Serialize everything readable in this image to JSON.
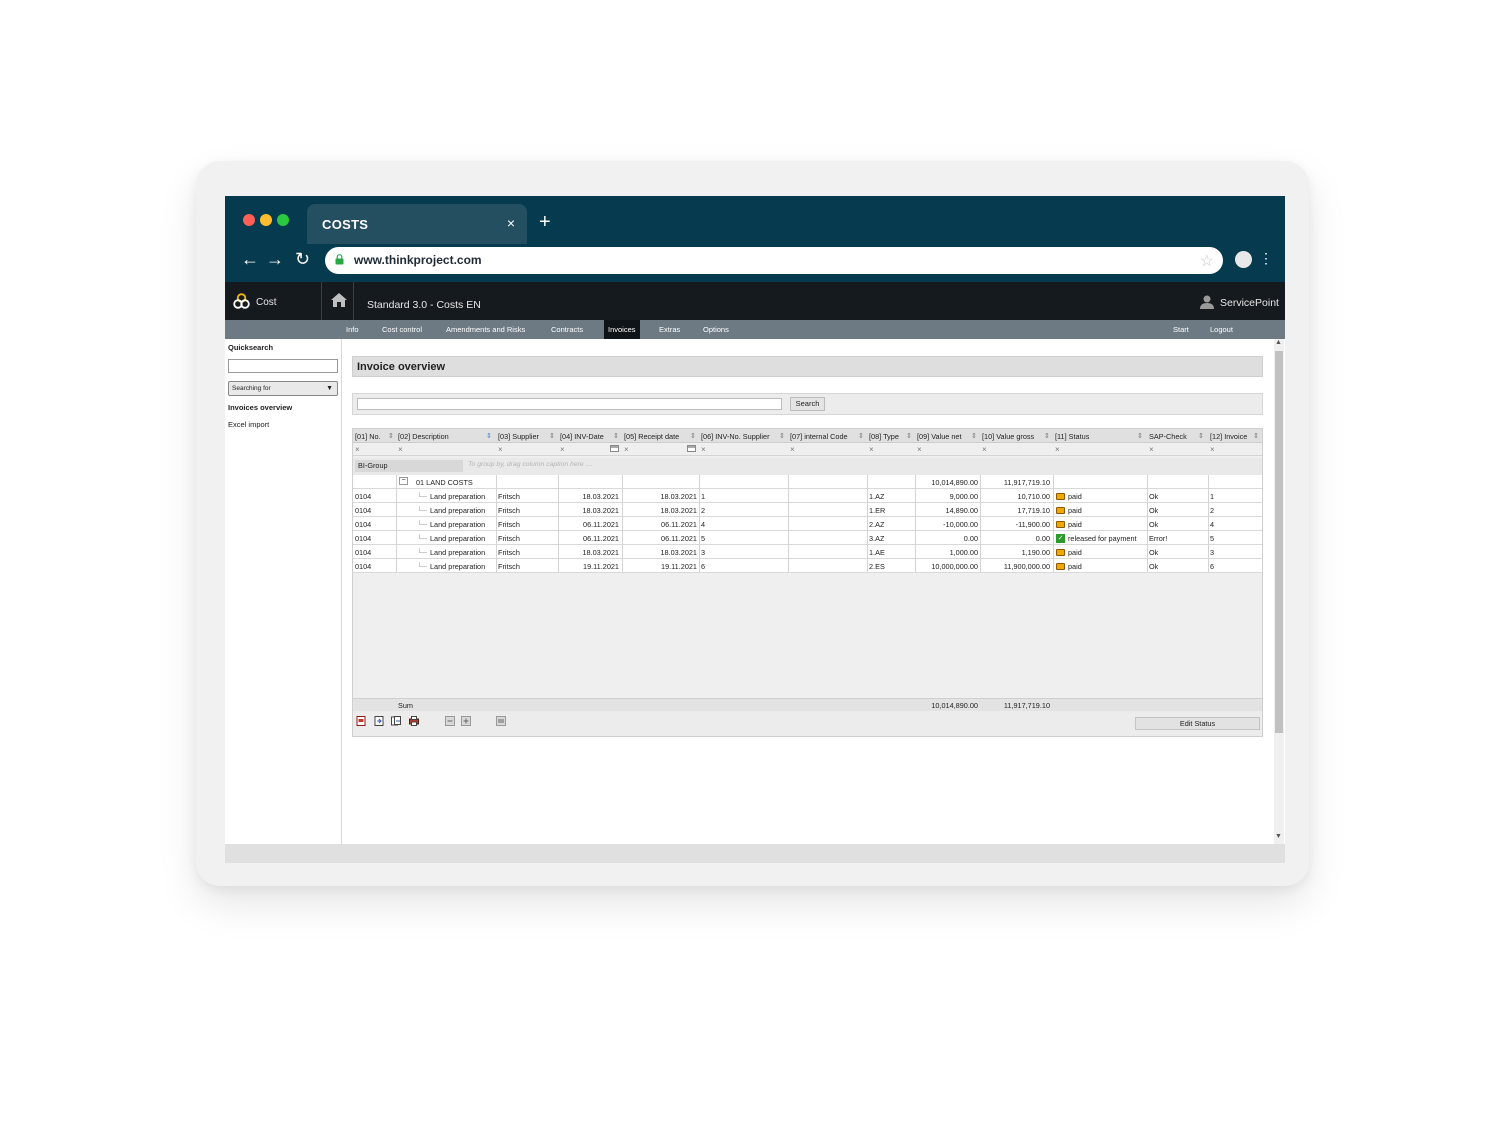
{
  "browser": {
    "tab_title": "COSTS",
    "tab_close": "×",
    "new_tab": "+",
    "url": "www.thinkproject.com",
    "back": "←",
    "forward": "→",
    "reload": "↻",
    "star": "☆",
    "menu": "⋮",
    "traffic_colors": [
      "#ff5f57",
      "#febc2e",
      "#28c840"
    ]
  },
  "app": {
    "name": "Cost",
    "project_title": "Standard 3.0 - Costs EN",
    "user": "ServicePoint"
  },
  "menu": {
    "items": [
      "Info",
      "Cost control",
      "Amendments and Risks",
      "Contracts",
      "Invoices",
      "Extras",
      "Options"
    ],
    "active": "Invoices",
    "right_items": [
      "Start",
      "Logout"
    ]
  },
  "sidebar": {
    "quicksearch_label": "Quicksearch",
    "quicksearch_value": "",
    "search_select": "Searching for",
    "nav": [
      "Invoices overview",
      "Excel import"
    ]
  },
  "main": {
    "page_title": "Invoice overview",
    "search_value": "",
    "search_button": "Search",
    "filter_clear": "×",
    "group_chip": "BI-Group",
    "drag_hint": "To group by, drag column caption here ....",
    "group_toggle": "−",
    "group_label": "01 LAND COSTS",
    "group_value_net": "10,014,890.00",
    "group_value_gross": "11,917,719.10",
    "columns": [
      "[01] No.",
      "[02] Description",
      "[03] Supplier",
      "[04] INV-Date",
      "[05] Receipt date",
      "[06] INV-No. Supplier",
      "[07] internal Code",
      "[08] Type",
      "[09] Value net",
      "[10] Value gross",
      "[11] Status",
      "SAP-Check",
      "[12] Invoice"
    ],
    "rows": [
      {
        "no": "0104",
        "desc": "Land preparation",
        "supplier": "Fritsch",
        "inv_date": "18.03.2021",
        "receipt": "18.03.2021",
        "inv_no": "1",
        "code": "",
        "type": "1.AZ",
        "net": "9,000.00",
        "gross": "10,710.00",
        "status": "paid",
        "status_icon": "paid-icon",
        "sap": "Ok",
        "invoice": "1"
      },
      {
        "no": "0104",
        "desc": "Land preparation",
        "supplier": "Fritsch",
        "inv_date": "18.03.2021",
        "receipt": "18.03.2021",
        "inv_no": "2",
        "code": "",
        "type": "1.ER",
        "net": "14,890.00",
        "gross": "17,719.10",
        "status": "paid",
        "status_icon": "paid-icon",
        "sap": "Ok",
        "invoice": "2"
      },
      {
        "no": "0104",
        "desc": "Land preparation",
        "supplier": "Fritsch",
        "inv_date": "06.11.2021",
        "receipt": "06.11.2021",
        "inv_no": "4",
        "code": "",
        "type": "2.AZ",
        "net": "-10,000.00",
        "gross": "-11,900.00",
        "status": "paid",
        "status_icon": "paid-icon",
        "sap": "Ok",
        "invoice": "4"
      },
      {
        "no": "0104",
        "desc": "Land preparation",
        "supplier": "Fritsch",
        "inv_date": "06.11.2021",
        "receipt": "06.11.2021",
        "inv_no": "5",
        "code": "",
        "type": "3.AZ",
        "net": "0.00",
        "gross": "0.00",
        "status": "released for payment",
        "status_icon": "check-icon",
        "sap": "Error!",
        "invoice": "5"
      },
      {
        "no": "0104",
        "desc": "Land preparation",
        "supplier": "Fritsch",
        "inv_date": "18.03.2021",
        "receipt": "18.03.2021",
        "inv_no": "3",
        "code": "",
        "type": "1.AE",
        "net": "1,000.00",
        "gross": "1,190.00",
        "status": "paid",
        "status_icon": "paid-icon",
        "sap": "Ok",
        "invoice": "3"
      },
      {
        "no": "0104",
        "desc": "Land preparation",
        "supplier": "Fritsch",
        "inv_date": "19.11.2021",
        "receipt": "19.11.2021",
        "inv_no": "6",
        "code": "",
        "type": "2.ES",
        "net": "10,000,000.00",
        "gross": "11,900,000.00",
        "status": "paid",
        "status_icon": "paid-icon",
        "sap": "Ok",
        "invoice": "6"
      }
    ],
    "sum_label": "Sum",
    "sum_net": "10,014,890.00",
    "sum_gross": "11,917,719.10",
    "edit_status_button": "Edit Status",
    "colors": {
      "paid": "#f0a800",
      "released": "#2a9a2a",
      "header_bg": "#151a1f",
      "chrome_bg": "#063a4e"
    }
  }
}
